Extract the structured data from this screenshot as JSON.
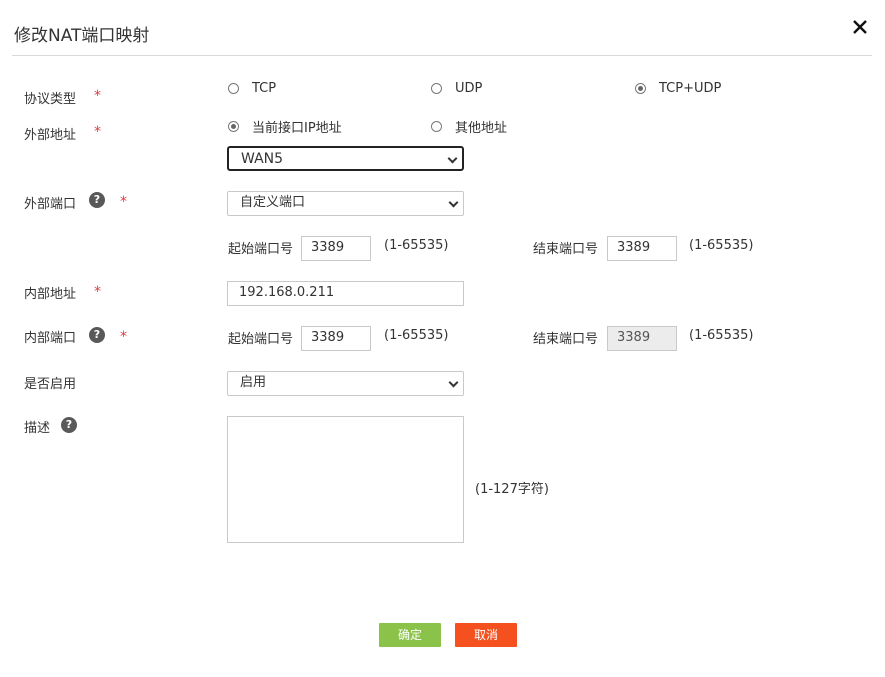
{
  "dialog": {
    "title": "修改NAT端口映射"
  },
  "protocol": {
    "label": "协议类型",
    "options": [
      "TCP",
      "UDP",
      "TCP+UDP"
    ],
    "selected": "TCP+UDP"
  },
  "external_address": {
    "label": "外部地址",
    "options": [
      "当前接口IP地址",
      "其他地址"
    ],
    "selected": "当前接口IP地址",
    "interface_value": "WAN5"
  },
  "external_port": {
    "label": "外部端口",
    "mode_value": "自定义端口",
    "start_label": "起始端口号",
    "start_value": "3389",
    "start_range": "(1-65535)",
    "end_label": "结束端口号",
    "end_value": "3389",
    "end_range": "(1-65535)"
  },
  "internal_address": {
    "label": "内部地址",
    "value": "192.168.0.211"
  },
  "internal_port": {
    "label": "内部端口",
    "start_label": "起始端口号",
    "start_value": "3389",
    "start_range": "(1-65535)",
    "end_label": "结束端口号",
    "end_value": "3389",
    "end_range": "(1-65535)"
  },
  "enable": {
    "label": "是否启用",
    "value": "启用"
  },
  "description": {
    "label": "描述",
    "value": "",
    "hint": "(1-127字符)"
  },
  "buttons": {
    "confirm": "确定",
    "cancel": "取消"
  },
  "colors": {
    "required": "#e4393c",
    "confirm": "#8bc34a",
    "cancel": "#f4511e"
  }
}
